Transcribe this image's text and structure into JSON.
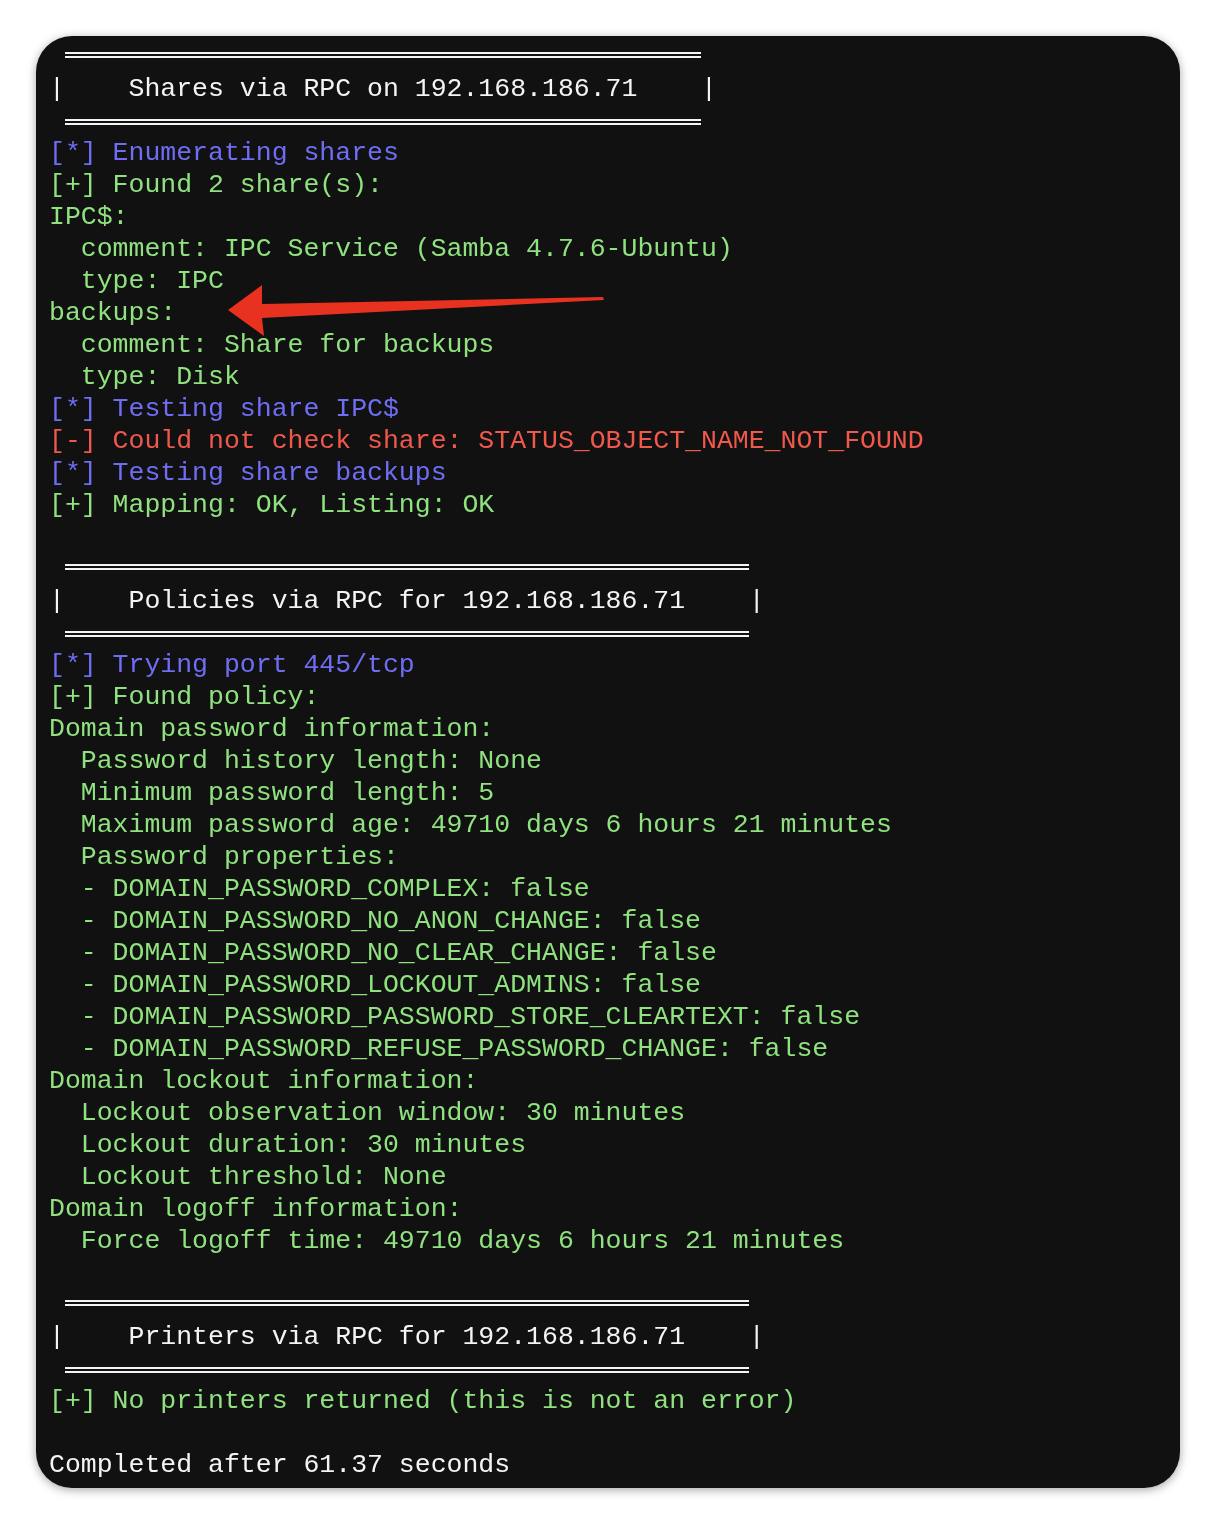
{
  "terminal": {
    "lines": [
      {
        "kind": "banner",
        "text": "|    Shares via RPC on 192.168.186.71    |"
      },
      {
        "kind": "text",
        "color": "#6e6ef5",
        "text": "[*] Enumerating shares"
      },
      {
        "kind": "text",
        "color": "#8fe27f",
        "text": "[+] Found 2 share(s):"
      },
      {
        "kind": "text",
        "color": "#8fe27f",
        "text": "IPC$:"
      },
      {
        "kind": "text",
        "color": "#8fe27f",
        "text": "  comment: IPC Service (Samba 4.7.6-Ubuntu)"
      },
      {
        "kind": "text",
        "color": "#8fe27f",
        "text": "  type: IPC"
      },
      {
        "kind": "text",
        "color": "#8fe27f",
        "text": "backups:"
      },
      {
        "kind": "text",
        "color": "#8fe27f",
        "text": "  comment: Share for backups"
      },
      {
        "kind": "text",
        "color": "#8fe27f",
        "text": "  type: Disk"
      },
      {
        "kind": "text",
        "color": "#6e6ef5",
        "text": "[*] Testing share IPC$"
      },
      {
        "kind": "text",
        "color": "#f0584c",
        "text": "[-] Could not check share: STATUS_OBJECT_NAME_NOT_FOUND"
      },
      {
        "kind": "text",
        "color": "#6e6ef5",
        "text": "[*] Testing share backups"
      },
      {
        "kind": "text",
        "color": "#8fe27f",
        "text": "[+] Mapping: OK, Listing: OK"
      },
      {
        "kind": "blank"
      },
      {
        "kind": "banner",
        "text": "|    Policies via RPC for 192.168.186.71    |"
      },
      {
        "kind": "text",
        "color": "#6e6ef5",
        "text": "[*] Trying port 445/tcp"
      },
      {
        "kind": "text",
        "color": "#8fe27f",
        "text": "[+] Found policy:"
      },
      {
        "kind": "text",
        "color": "#8fe27f",
        "text": "Domain password information:"
      },
      {
        "kind": "text",
        "color": "#8fe27f",
        "text": "  Password history length: None"
      },
      {
        "kind": "text",
        "color": "#8fe27f",
        "text": "  Minimum password length: 5"
      },
      {
        "kind": "text",
        "color": "#8fe27f",
        "text": "  Maximum password age: 49710 days 6 hours 21 minutes"
      },
      {
        "kind": "text",
        "color": "#8fe27f",
        "text": "  Password properties:"
      },
      {
        "kind": "text",
        "color": "#8fe27f",
        "text": "  - DOMAIN_PASSWORD_COMPLEX: false"
      },
      {
        "kind": "text",
        "color": "#8fe27f",
        "text": "  - DOMAIN_PASSWORD_NO_ANON_CHANGE: false"
      },
      {
        "kind": "text",
        "color": "#8fe27f",
        "text": "  - DOMAIN_PASSWORD_NO_CLEAR_CHANGE: false"
      },
      {
        "kind": "text",
        "color": "#8fe27f",
        "text": "  - DOMAIN_PASSWORD_LOCKOUT_ADMINS: false"
      },
      {
        "kind": "text",
        "color": "#8fe27f",
        "text": "  - DOMAIN_PASSWORD_PASSWORD_STORE_CLEARTEXT: false"
      },
      {
        "kind": "text",
        "color": "#8fe27f",
        "text": "  - DOMAIN_PASSWORD_REFUSE_PASSWORD_CHANGE: false"
      },
      {
        "kind": "text",
        "color": "#8fe27f",
        "text": "Domain lockout information:"
      },
      {
        "kind": "text",
        "color": "#8fe27f",
        "text": "  Lockout observation window: 30 minutes"
      },
      {
        "kind": "text",
        "color": "#8fe27f",
        "text": "  Lockout duration: 30 minutes"
      },
      {
        "kind": "text",
        "color": "#8fe27f",
        "text": "  Lockout threshold: None"
      },
      {
        "kind": "text",
        "color": "#8fe27f",
        "text": "Domain logoff information:"
      },
      {
        "kind": "text",
        "color": "#8fe27f",
        "text": "  Force logoff time: 49710 days 6 hours 21 minutes"
      },
      {
        "kind": "blank"
      },
      {
        "kind": "banner",
        "text": "|    Printers via RPC for 192.168.186.71    |"
      },
      {
        "kind": "text",
        "color": "#8fe27f",
        "text": "[+] No printers returned (this is not an error)"
      },
      {
        "kind": "blank"
      },
      {
        "kind": "text",
        "color": "#f4f4f4",
        "text": "Completed after 61.37 seconds"
      }
    ]
  }
}
